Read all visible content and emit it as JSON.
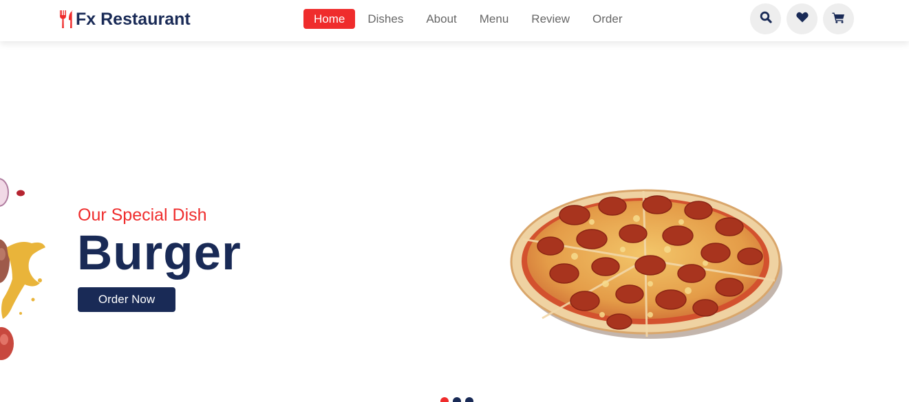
{
  "brand": {
    "name": "Fx Restaurant",
    "icon": "utensils-icon",
    "accent": "#ef2c2c",
    "primary": "#192a56"
  },
  "nav": {
    "items": [
      {
        "label": "Home",
        "active": true
      },
      {
        "label": "Dishes"
      },
      {
        "label": "About"
      },
      {
        "label": "Menu"
      },
      {
        "label": "Review"
      },
      {
        "label": "Order"
      }
    ]
  },
  "header_icons": [
    "search-icon",
    "heart-icon",
    "cart-icon"
  ],
  "hero": {
    "subtitle": "Our Special Dish",
    "title": "Burger",
    "button_label": "Order Now",
    "image": "pizza-image"
  },
  "slider": {
    "dots": 3,
    "active_index": 0
  }
}
